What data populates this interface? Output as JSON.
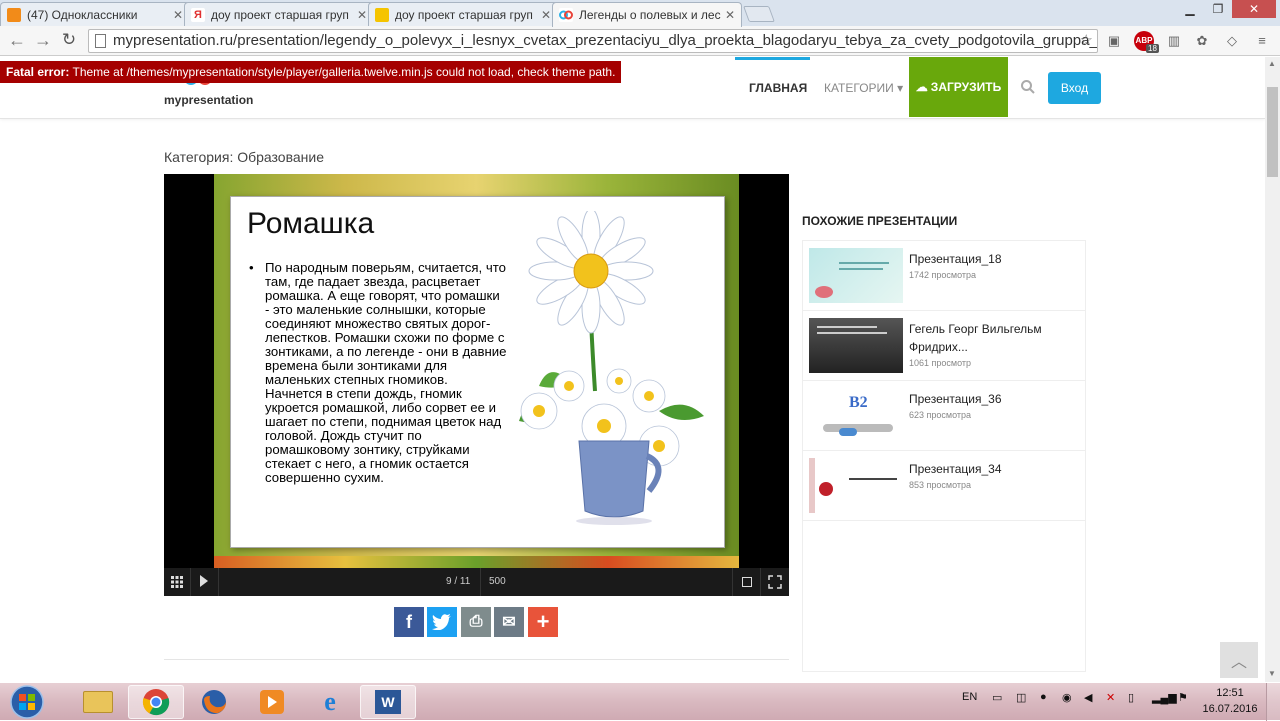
{
  "browser": {
    "tabs": [
      {
        "label": "(47) Одноклассники",
        "icon_color": "#f28b19",
        "active": false
      },
      {
        "label": "доу проект старшая груп",
        "icon_color": "#e03030",
        "active": false
      },
      {
        "label": "доу проект старшая груп",
        "icon_color": "#f5c400",
        "active": false
      },
      {
        "label": "Легенды о полевых и лес",
        "icon_color": "#e8443a",
        "active": true
      }
    ],
    "url": "mypresentation.ru/presentation/legendy_o_polevyx_i_lesnyx_cvetax_prezentaciyu_dlya_proekta_blagodaryu_tebya_za_cvety_podgotovila_gruppa_i",
    "abp_label": "ABP",
    "abp_count": "18"
  },
  "error": {
    "prefix": "Fatal error:",
    "message": "Theme at /themes/mypresentation/style/player/galleria.twelve.min.js could not load, check theme path."
  },
  "site": {
    "logo": "mypresentation",
    "nav": {
      "home": "ГЛАВНАЯ",
      "categories": "КАТЕГОРИИ ▾",
      "upload": "ЗАГРУЗИТЬ",
      "login": "Вход"
    },
    "category": "Категория: Образование"
  },
  "slide": {
    "title": "Ромашка",
    "text": "По народным поверьям, считается, что там, где падает звезда, расцветает ромашка. А еще говорят, что ромашки - это маленькие солнышки, которые соединяют множество святых дорог-лепестков. Ромашки схожи по форме с зонтиками, а по легенде - они в давние времена были зонтиками для маленьких степных гномиков. Начнется в степи дождь, гномик укроется ромашкой, либо сорвет ее и шагает по степи, поднимая цветок над головой. Дождь стучит по ромашковому зонтику, струйками стекает с него, а гномик остается совершенно сухим."
  },
  "player": {
    "counter": "9 / 11",
    "speed": "500"
  },
  "share": [
    {
      "name": "facebook",
      "glyph": "f",
      "color": "#3b5998"
    },
    {
      "name": "twitter",
      "glyph": "t",
      "color": "#1da1f2"
    },
    {
      "name": "print",
      "glyph": "⎙",
      "color": "#7f8c8d"
    },
    {
      "name": "email",
      "glyph": "✉",
      "color": "#6d7b86"
    },
    {
      "name": "more",
      "glyph": "+",
      "color": "#e8543a"
    }
  ],
  "similar": {
    "title": "ПОХОЖИЕ ПРЕЗЕНТАЦИИ",
    "items": [
      {
        "title": "Презентация_18",
        "views": "1742 просмотра"
      },
      {
        "title": "Гегель Георг Вильгельм Фридрих...",
        "views": "1061 просмотр"
      },
      {
        "title": "Презентация_36",
        "views": "623 просмотра"
      },
      {
        "title": "Презентация_34",
        "views": "853 просмотра"
      }
    ]
  },
  "taskbar": {
    "lang": "EN",
    "time": "12:51",
    "date": "16.07.2016"
  }
}
